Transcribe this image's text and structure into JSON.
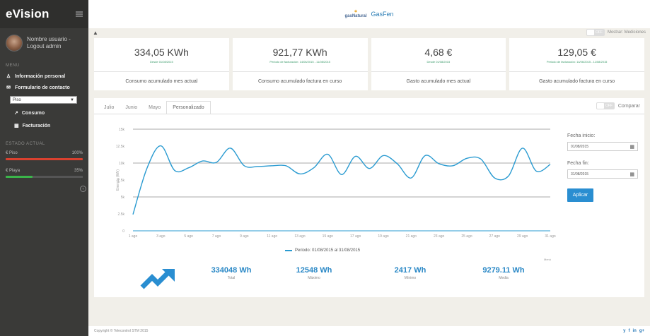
{
  "app": {
    "title": "eVision"
  },
  "brand": {
    "top_logo_line1": "gasNatural",
    "name": "GasFen"
  },
  "user": {
    "name": "Nombre usuario - Logout admin"
  },
  "sidebar": {
    "menu_heading": "MENU",
    "items": [
      {
        "label": "Información personal",
        "icon": "user-icon"
      },
      {
        "label": "Formulario de contacto",
        "icon": "envelope-icon"
      }
    ],
    "select_value": "Piso",
    "sub_items": [
      {
        "label": "Consumo",
        "icon": "line-chart-icon"
      },
      {
        "label": "Facturación",
        "icon": "bar-chart-icon"
      }
    ],
    "balance_heading": "ESTADO ACTUAL",
    "balances": [
      {
        "label": "Piso",
        "value": "100%",
        "color": "#d9412f",
        "fill": 1.0
      },
      {
        "label": "Playa",
        "value": "35%",
        "color": "#3bb54a",
        "fill": 0.35
      }
    ]
  },
  "subbar": {
    "toggle_state": "OFF",
    "toggle_label": "Mostrar: Mediciones"
  },
  "cards": [
    {
      "value": "334,05 KWh",
      "sub": "Desde 01/08/2015",
      "label": "Consumo acumulado mes actual"
    },
    {
      "value": "921,77 KWh",
      "sub": "Periodo de facturación: 14/06/2015 - 11/08/2015",
      "label": "Consumo acumulado factura en curso"
    },
    {
      "value": "4,68 €",
      "sub": "Desde 01/08/2015",
      "label": "Gasto acumulado mes actual"
    },
    {
      "value": "129,05 €",
      "sub": "Periodo de facturación: 14/06/2015 - 11/08/2015",
      "label": "Gasto acumulado factura en curso"
    }
  ],
  "tabs": [
    "Julio",
    "Junio",
    "Mayo",
    "Personalizado"
  ],
  "compare": {
    "toggle_state": "OFF",
    "label": "Comparar"
  },
  "form": {
    "start_label": "Fecha inicio:",
    "start_value": "01/08/2015",
    "end_label": "Fecha fin:",
    "end_value": "31/08/2015",
    "apply_label": "Aplicar"
  },
  "chart_data": {
    "type": "line",
    "ylabel": "Energía (Wh)",
    "yticks": [
      "0",
      "2.5k",
      "5k",
      "7.5k",
      "10k",
      "12.5k",
      "15k"
    ],
    "ylim": [
      0,
      15000
    ],
    "grid": true,
    "x": [
      "1 ago",
      "2 ago",
      "3 ago",
      "4 ago",
      "5 ago",
      "6 ago",
      "7 ago",
      "8 ago",
      "9 ago",
      "10 ago",
      "11 ago",
      "12 ago",
      "13 ago",
      "14 ago",
      "15 ago",
      "16 ago",
      "17 ago",
      "18 ago",
      "19 ago",
      "20 ago",
      "21 ago",
      "22 ago",
      "23 ago",
      "24 ago",
      "25 ago",
      "26 ago",
      "27 ago",
      "28 ago",
      "29 ago",
      "30 ago",
      "31 ago"
    ],
    "series": [
      {
        "name": "Periodo: 01/08/2015 al 31/08/2015",
        "color": "#2a9bd1",
        "values": [
          2417,
          9200,
          12548,
          8900,
          9300,
          10300,
          10100,
          12200,
          9600,
          9500,
          9600,
          9600,
          8400,
          9300,
          11300,
          8300,
          11000,
          9200,
          11100,
          9900,
          7800,
          11100,
          9900,
          9600,
          10700,
          10600,
          7800,
          8100,
          12200,
          8800,
          9800
        ]
      }
    ]
  },
  "legend_label": "Periodo: 01/08/2015 al 31/08/2015",
  "chart_menu": "Menú",
  "stats": [
    {
      "value": "334048 Wh",
      "label": "Total"
    },
    {
      "value": "12548 Wh",
      "label": "Máximo"
    },
    {
      "value": "2417 Wh",
      "label": "Mínimo"
    },
    {
      "value": "9279.11 Wh",
      "label": "Media"
    }
  ],
  "footer": {
    "copyright": "Copyright © Telecontrol STM 2015",
    "socials": [
      "y",
      "f",
      "in",
      "g+"
    ]
  }
}
